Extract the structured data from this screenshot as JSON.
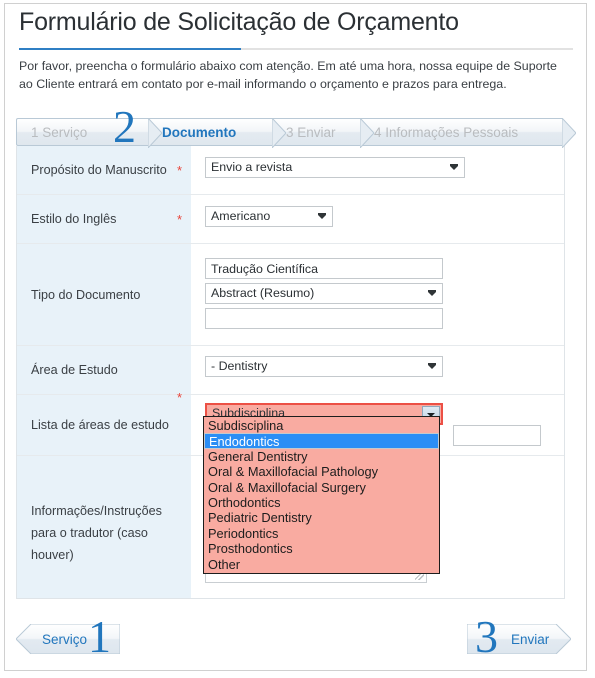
{
  "header": {
    "title": "Formulário de Solicitação de Orçamento",
    "intro": "Por favor, preencha o formulário abaixo com atenção. Em até uma hora, nossa equipe de Suporte ao Cliente entrará em contato por e-mail informando o orçamento e prazos para entrega."
  },
  "colors": {
    "accent_blue": "#2176bd",
    "label_bg": "#e8f2f9",
    "error_pink": "#f9aba1",
    "error_border": "#ec5045",
    "highlight_blue": "#2b8ef5",
    "required_red": "#e8443a"
  },
  "steps": {
    "current_number": "2",
    "items": [
      {
        "label": "1 Serviço",
        "active": false
      },
      {
        "label": "Documento",
        "active": true
      },
      {
        "label": "3 Enviar",
        "active": false
      },
      {
        "label": "4 Informações Pessoais",
        "active": false
      }
    ]
  },
  "form": {
    "rows": [
      {
        "label": "Propósito do Manuscrito",
        "required": "*",
        "field_value": "Envio a revista"
      },
      {
        "label": "Estilo do Inglês",
        "required": "*",
        "field_value": "Americano"
      },
      {
        "label": "Tipo do Documento",
        "required": "",
        "text_value": "Tradução Científica",
        "select_value": "Abstract (Resumo)",
        "extra_value": ""
      },
      {
        "label": "Área de Estudo",
        "required": "",
        "field_value": "- Dentistry"
      },
      {
        "label": "Lista de áreas de estudo",
        "required": "*",
        "field_value": "Subdisciplina",
        "extra_value": ""
      },
      {
        "label_line1": "Informações/Instruções",
        "label_line2": "para o tradutor (caso",
        "label_line3": "houver)",
        "required": "",
        "textarea_value": ""
      }
    ]
  },
  "dropdown": {
    "open": true,
    "selected": "Endodontics",
    "options": [
      "Subdisciplina",
      "Endodontics",
      "General Dentistry",
      "Oral & Maxillofacial Pathology",
      "Oral & Maxillofacial Surgery",
      "Orthodontics",
      "Pediatric Dentistry",
      "Periodontics",
      "Prosthodontics",
      "Other"
    ]
  },
  "nav": {
    "prev_label": "Serviço",
    "prev_number": "1",
    "next_label": "Enviar",
    "next_number": "3"
  }
}
